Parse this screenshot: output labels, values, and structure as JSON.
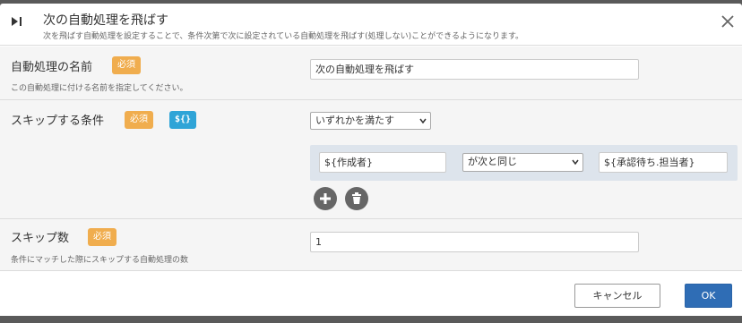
{
  "dialog": {
    "title": "次の自動処理を飛ばす",
    "subtitle": "次を飛ばす自動処理を設定することで、条件次第で次に設定されている自動処理を飛ばす(処理しない)ことができるようになります。",
    "icon": "skip-next-icon",
    "close_icon": "close-icon"
  },
  "fields": {
    "name": {
      "label": "自動処理の名前",
      "required_badge": "必須",
      "description": "この自動処理に付ける名前を指定してください。",
      "value": "次の自動処理を飛ばす"
    },
    "condition": {
      "label": "スキップする条件",
      "required_badge": "必須",
      "variable_badge": "${}",
      "match_mode": "いずれかを満たす",
      "rows": [
        {
          "left": "${作成者}",
          "operator": "が次と同じ",
          "right": "${承認待ち.担当者}"
        }
      ],
      "add_icon": "plus-icon",
      "delete_icon": "trash-icon"
    },
    "skip_count": {
      "label": "スキップ数",
      "required_badge": "必須",
      "description": "条件にマッチした際にスキップする自動処理の数",
      "value": "1"
    }
  },
  "footer": {
    "cancel_label": "キャンセル",
    "ok_label": "OK"
  },
  "colors": {
    "required_badge": "#f0ad4e",
    "variable_badge": "#2fa4d7",
    "primary_button": "#2f6db5",
    "condition_panel": "#dde4ec"
  }
}
